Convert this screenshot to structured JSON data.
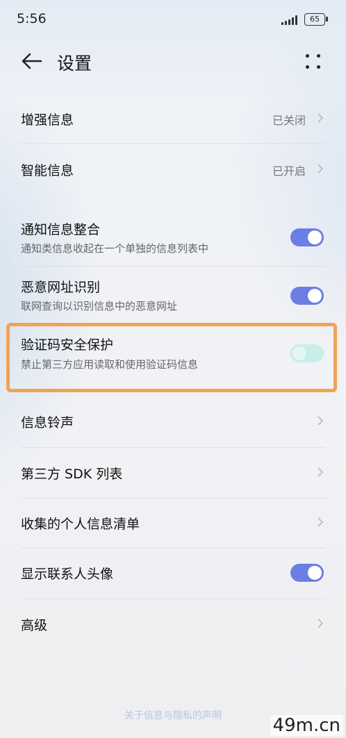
{
  "status_bar": {
    "time": "5:56",
    "battery": "65"
  },
  "header": {
    "title": "设置"
  },
  "items": [
    {
      "label": "增强信息",
      "value": "已关闭"
    },
    {
      "label": "智能信息",
      "value": "已开启"
    },
    {
      "label": "通知信息整合",
      "subtitle": "通知类信息收起在一个单独的信息列表中",
      "toggle": "on"
    },
    {
      "label": "恶意网址识别",
      "subtitle": "联网查询以识别信息中的恶意网址",
      "toggle": "on"
    },
    {
      "label": "验证码安全保护",
      "subtitle": "禁止第三方应用读取和使用验证码信息",
      "toggle": "off"
    },
    {
      "label": "信息铃声"
    },
    {
      "label": "第三方 SDK 列表"
    },
    {
      "label": "收集的个人信息清单"
    },
    {
      "label": "显示联系人头像",
      "toggle": "on"
    },
    {
      "label": "高级"
    }
  ],
  "footer": {
    "link": "关于信息与隐私的声明"
  },
  "watermark": "49m.cn",
  "colors": {
    "toggle_on": "#6b7ee3",
    "toggle_off": "#c9ede8",
    "highlight": "#f0a453"
  }
}
